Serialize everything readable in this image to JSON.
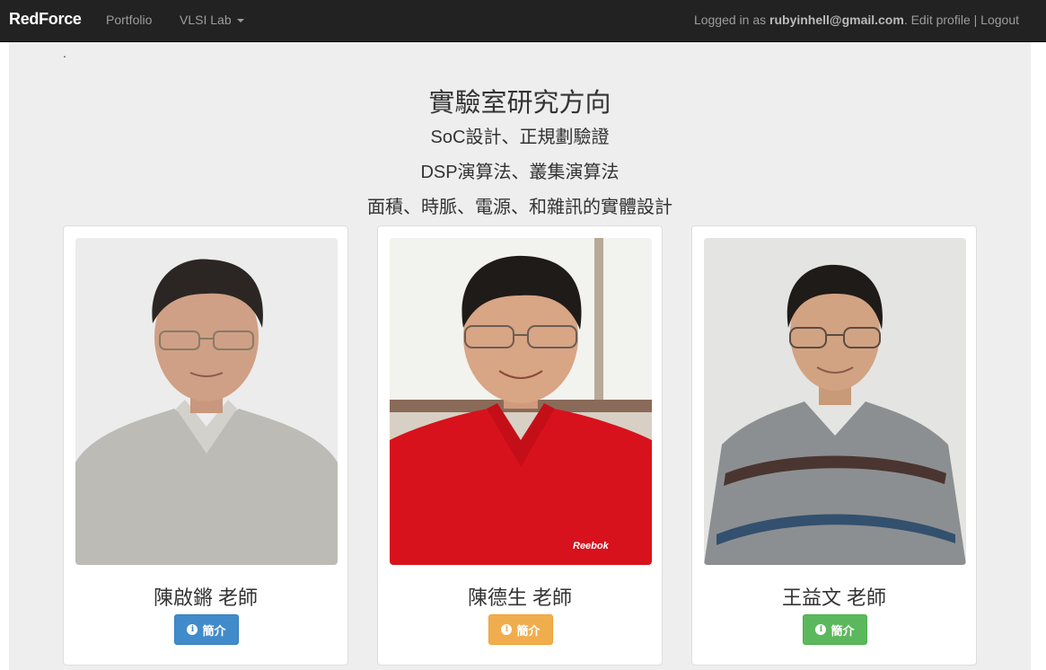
{
  "navbar": {
    "brand": "RedForce",
    "items": [
      {
        "label": "Portfolio"
      },
      {
        "label": "VLSI Lab",
        "dropdown": true
      }
    ],
    "user": {
      "prefix": "Logged in as ",
      "email": "rubyinhell@gmail.com",
      "suffix": ".",
      "edit_profile": "Edit profile",
      "separator": "|",
      "logout": "Logout"
    }
  },
  "main": {
    "dot": ".",
    "title": "實驗室研究方向",
    "lines": [
      "SoC設計、正規劃驗證",
      "DSP演算法、叢集演算法",
      "面積、時脈、電源、和雜訊的實體設計"
    ]
  },
  "professors": [
    {
      "name": "陳啟鏘 老師",
      "button": "簡介",
      "button_color": "#428bca",
      "photo": "professor-photo-gray-shirt"
    },
    {
      "name": "陳德生 老師",
      "button": "簡介",
      "button_color": "#f0ad4e",
      "photo": "professor-photo-red-polo"
    },
    {
      "name": "王益文 老師",
      "button": "簡介",
      "button_color": "#5cb85c",
      "photo": "professor-photo-striped-polo"
    }
  ],
  "icons": {
    "info": "info-circle-icon",
    "caret": "caret-down-icon"
  }
}
